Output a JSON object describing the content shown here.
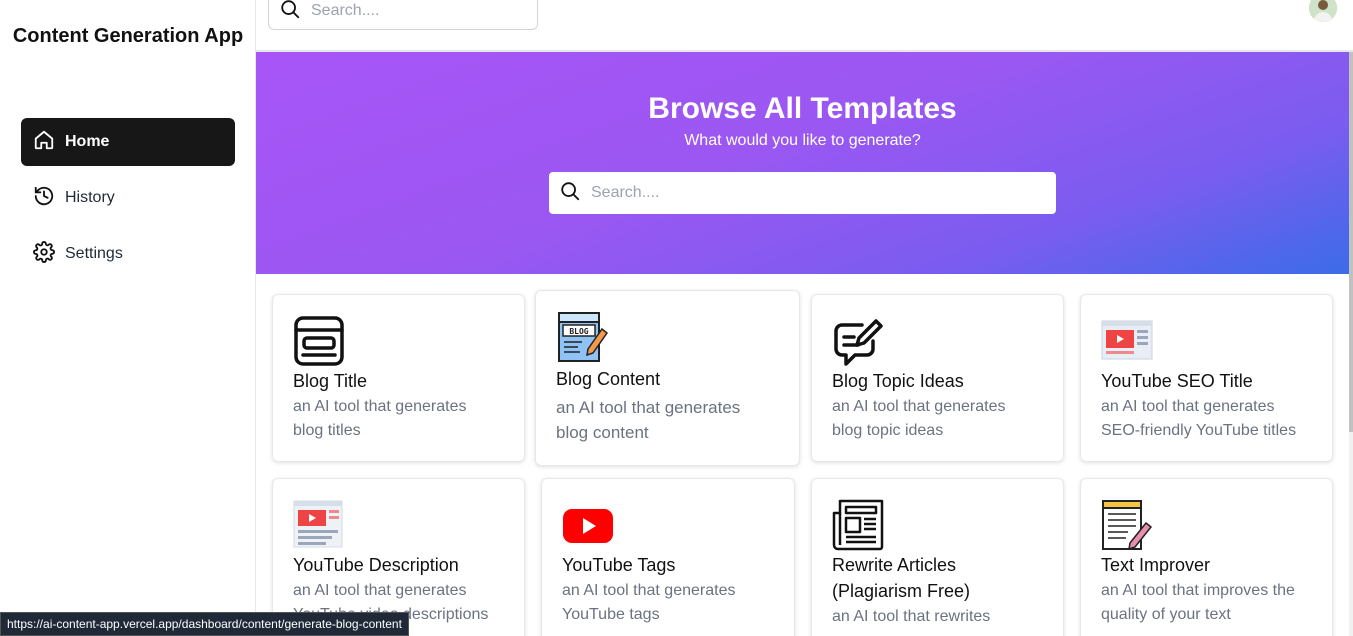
{
  "sidebar": {
    "brand": "Content Generation App",
    "items": [
      {
        "label": "Home",
        "icon": "home-icon",
        "active": true
      },
      {
        "label": "History",
        "icon": "history-icon",
        "active": false
      },
      {
        "label": "Settings",
        "icon": "gear-icon",
        "active": false
      }
    ]
  },
  "topbar": {
    "search_placeholder": "Search...."
  },
  "hero": {
    "title": "Browse All Templates",
    "subtitle": "What would you like to generate?",
    "search_placeholder": "Search....",
    "gradient_colors": [
      "#a855f7",
      "#3b6ce8"
    ]
  },
  "templates": [
    {
      "title": "Blog Title",
      "desc_line1": "an AI tool that generates",
      "desc_line2": "blog titles",
      "icon": "blog-title-icon"
    },
    {
      "title": "Blog Content",
      "desc_line1": "an AI tool that generates",
      "desc_line2": "blog content",
      "icon": "blog-content-icon"
    },
    {
      "title": "Blog Topic Ideas",
      "desc_line1": "an AI tool that generates",
      "desc_line2": "blog topic ideas",
      "icon": "blog-topic-icon"
    },
    {
      "title": "YouTube SEO Title",
      "desc_line1": "an AI tool that generates",
      "desc_line2": "SEO-friendly YouTube titles",
      "icon": "youtube-seo-icon"
    },
    {
      "title": "YouTube Description",
      "desc_line1": "an AI tool that generates",
      "desc_line2": "YouTube video descriptions",
      "icon": "youtube-description-icon"
    },
    {
      "title": "YouTube Tags",
      "desc_line1": "an AI tool that generates",
      "desc_line2": "YouTube tags",
      "icon": "youtube-play-icon"
    },
    {
      "title": "Rewrite Articles",
      "title_line2": "(Plagiarism Free)",
      "desc_line1": "an AI tool that rewrites",
      "icon": "newspaper-icon"
    },
    {
      "title": "Text Improver",
      "desc_line1": "an AI tool that improves the",
      "desc_line2": "quality of your text",
      "icon": "notepad-pencil-icon"
    }
  ],
  "statusbar": {
    "url": "https://ai-content-app.vercel.app/dashboard/content/generate-blog-content"
  },
  "colors": {
    "active_nav": "#171717",
    "youtube_red": "#ff0000"
  }
}
